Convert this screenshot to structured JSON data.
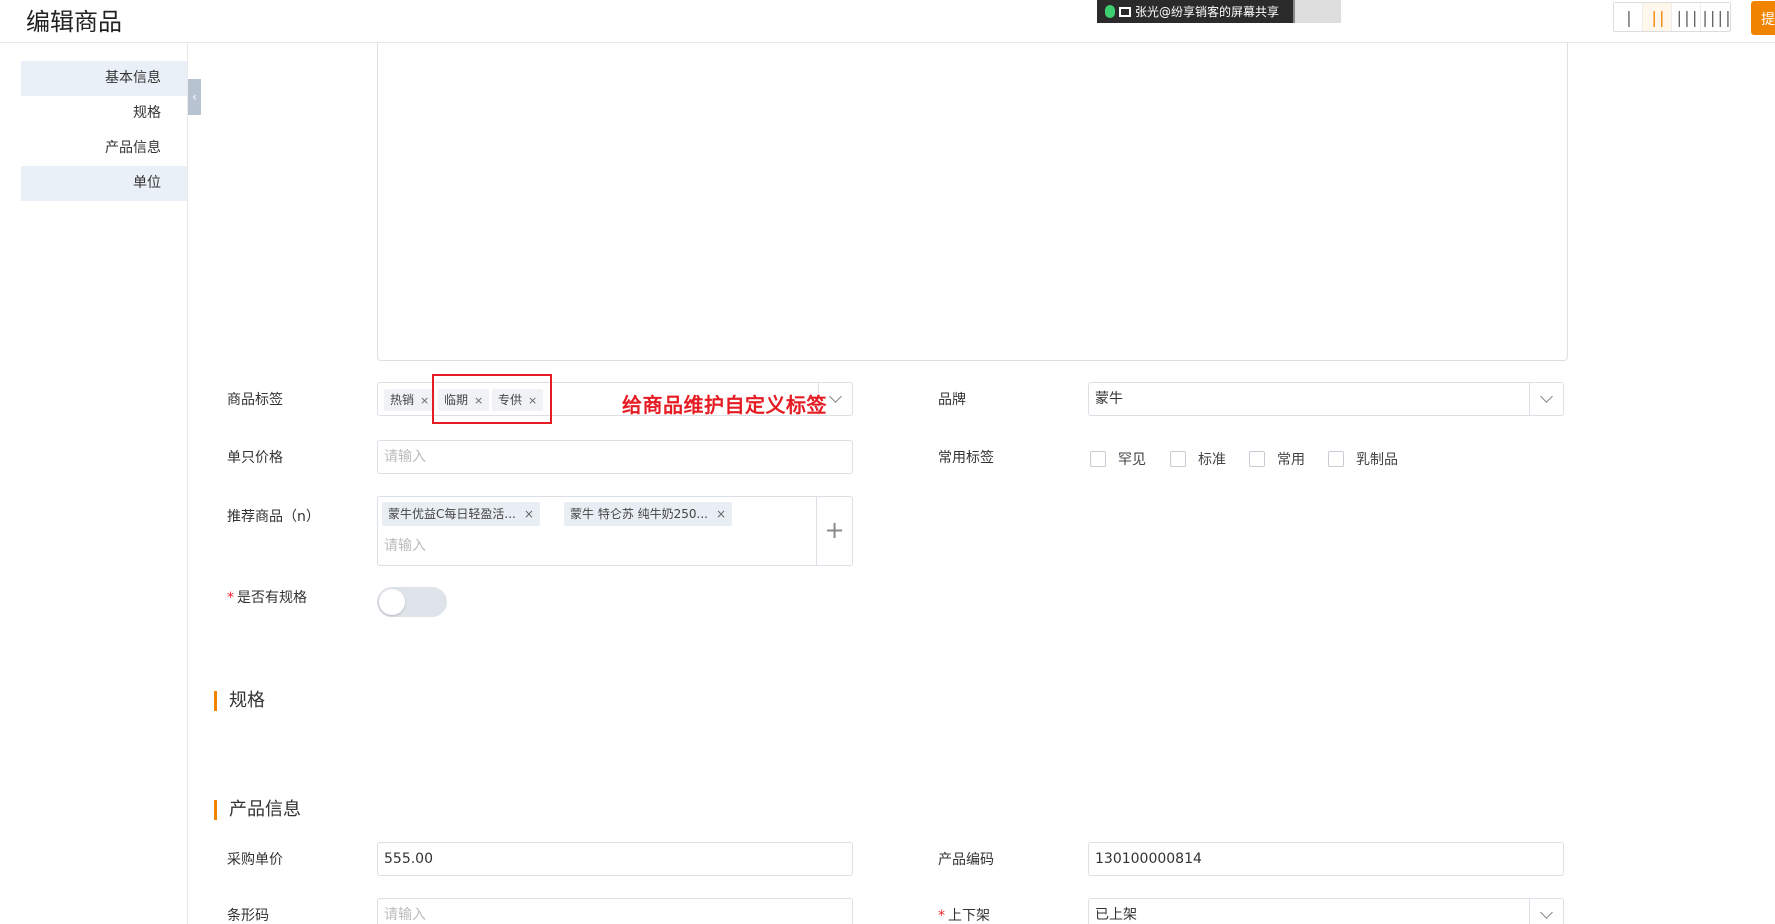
{
  "header": {
    "title": "编辑商品",
    "share_banner": "张光@纷享销客的屏幕共享",
    "column_switch": [
      "|",
      "||",
      "|||",
      "||||"
    ],
    "submit_label": "提"
  },
  "sidebar": {
    "items": [
      {
        "label": "基本信息",
        "highlight": true
      },
      {
        "label": "规格",
        "highlight": false
      },
      {
        "label": "产品信息",
        "highlight": false
      },
      {
        "label": "单位",
        "highlight": true
      }
    ],
    "collapse_icon": "‹"
  },
  "form": {
    "product_tags": {
      "label": "商品标签",
      "tags": [
        "热销",
        "临期",
        "专供"
      ],
      "remove": "×"
    },
    "annotation": "给商品维护自定义标签",
    "brand": {
      "label": "品牌",
      "value": "蒙牛"
    },
    "unit_price": {
      "label": "单只价格",
      "placeholder": "请输入"
    },
    "common_tags": {
      "label": "常用标签",
      "options": [
        "罕见",
        "标准",
        "常用",
        "乳制品"
      ]
    },
    "recommended": {
      "label": "推荐商品（n）",
      "items": [
        "蒙牛优益C每日轻盈活...",
        "蒙牛 特仑苏 纯牛奶250..."
      ],
      "remove": "×",
      "placeholder": "请输入",
      "add_icon": "+"
    },
    "has_spec": {
      "label": "是否有规格",
      "required_mark": "*",
      "on": false
    }
  },
  "sections": {
    "spec": "规格",
    "product_info": "产品信息"
  },
  "product_info": {
    "purchase_price": {
      "label": "采购单价",
      "value": "555.00"
    },
    "product_code": {
      "label": "产品编码",
      "value": "130100000814"
    },
    "barcode": {
      "label": "条形码",
      "placeholder": "请输入"
    },
    "shelf_status": {
      "label": "上下架",
      "required_mark": "*",
      "value": "已上架"
    }
  },
  "colors": {
    "accent": "#f08300",
    "annotation": "#e51c23",
    "highlight_bg": "#eaf0f8"
  }
}
